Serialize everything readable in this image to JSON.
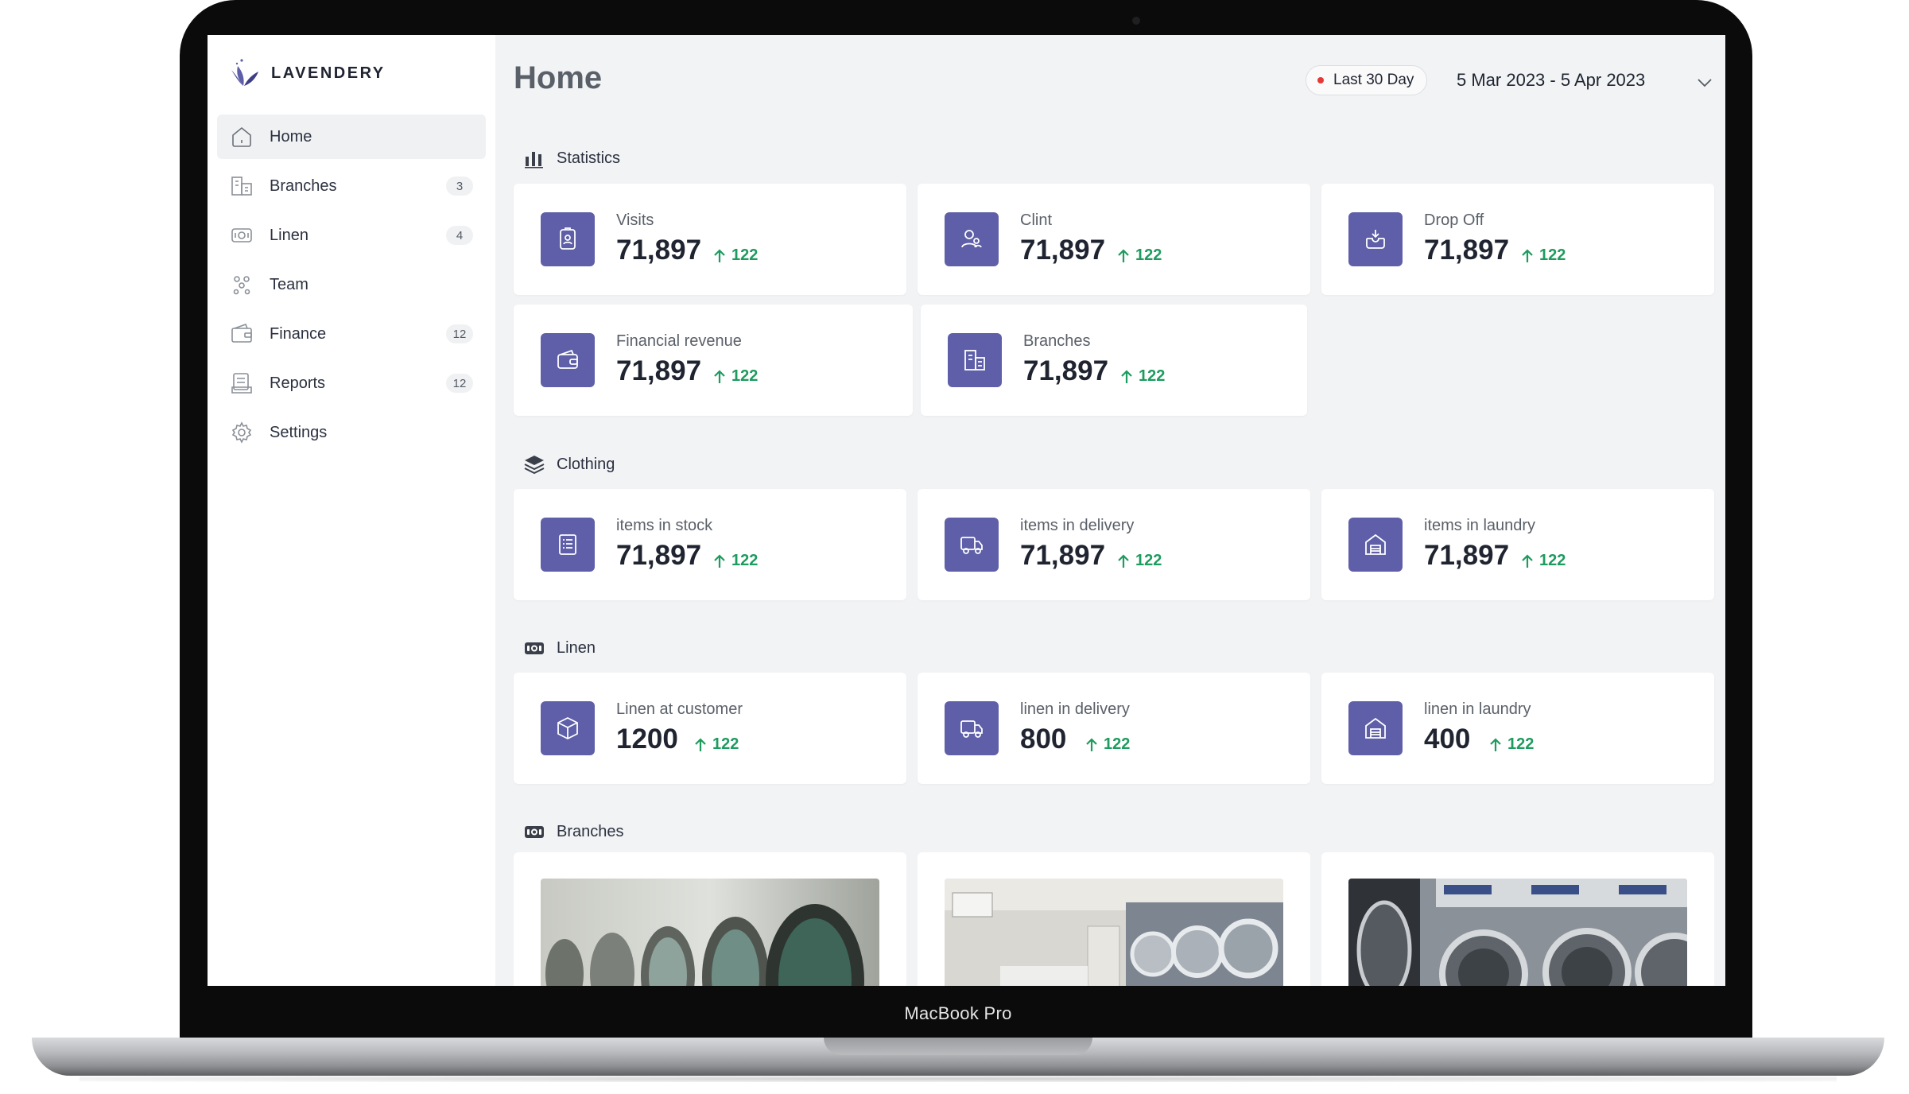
{
  "device": {
    "model": "MacBook Pro"
  },
  "brand": {
    "name": "LAVENDERY"
  },
  "sidebar": {
    "items": [
      {
        "label": "Home",
        "count": "",
        "icon": "home-icon",
        "active": true
      },
      {
        "label": "Branches",
        "count": "3",
        "icon": "branches-icon"
      },
      {
        "label": "Linen",
        "count": "4",
        "icon": "linen-icon"
      },
      {
        "label": "Team",
        "count": "",
        "icon": "team-icon"
      },
      {
        "label": "Finance",
        "count": "12",
        "icon": "finance-icon"
      },
      {
        "label": "Reports",
        "count": "12",
        "icon": "reports-icon"
      },
      {
        "label": "Settings",
        "count": "",
        "icon": "settings-icon"
      }
    ]
  },
  "header": {
    "title": "Home",
    "range_label": "Last 30 Day",
    "date_range": "5 Mar 2023 - 5 Apr 2023"
  },
  "sections": {
    "statistics": {
      "title": "Statistics",
      "cards": [
        {
          "label": "Visits",
          "value": "71,897",
          "delta": "122",
          "icon": "visitor-badge-icon"
        },
        {
          "label": "Clint",
          "value": "71,897",
          "delta": "122",
          "icon": "clients-icon"
        },
        {
          "label": "Drop Off",
          "value": "71,897",
          "delta": "122",
          "icon": "drop-off-icon"
        },
        {
          "label": "Financial revenue",
          "value": "71,897",
          "delta": "122",
          "icon": "wallet-icon"
        },
        {
          "label": "Branches",
          "value": "71,897",
          "delta": "122",
          "icon": "branches-icon"
        }
      ]
    },
    "clothing": {
      "title": "Clothing",
      "cards": [
        {
          "label": "items in stock",
          "value": "71,897",
          "delta": "122",
          "icon": "stock-list-icon"
        },
        {
          "label": "items in delivery",
          "value": "71,897",
          "delta": "122",
          "icon": "delivery-truck-icon"
        },
        {
          "label": "items in laundry",
          "value": "71,897",
          "delta": "122",
          "icon": "laundry-house-icon"
        }
      ]
    },
    "linen": {
      "title": "Linen",
      "cards": [
        {
          "label": "Linen at customer",
          "value": "1200",
          "delta": "122",
          "icon": "package-icon"
        },
        {
          "label": "linen in delivery",
          "value": "800",
          "delta": "122",
          "icon": "delivery-truck-icon"
        },
        {
          "label": "linen in laundry",
          "value": "400",
          "delta": "122",
          "icon": "laundry-house-icon"
        }
      ]
    },
    "branches": {
      "title": "Branches",
      "photos": [
        "laundromat-photo-1",
        "laundromat-photo-2",
        "laundromat-photo-3"
      ]
    }
  },
  "colors": {
    "accent": "#5e5fa8",
    "positive": "#1e9b5f",
    "live_dot": "#e53935",
    "background": "#f2f3f5"
  }
}
